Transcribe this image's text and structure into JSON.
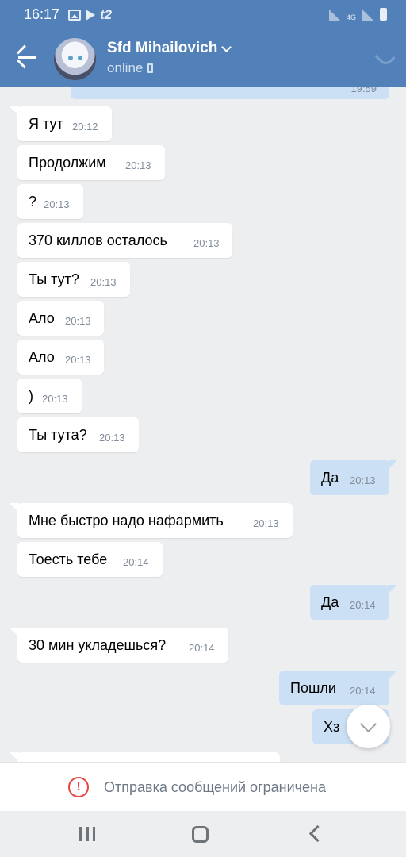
{
  "status_bar": {
    "time": "16:17",
    "carrier": "t2",
    "network": "4G",
    "icons": [
      "image-icon",
      "play-icon",
      "t2-icon",
      "signal-icon",
      "signal-icon",
      "battery-icon"
    ]
  },
  "header": {
    "name": "Sfd Mihailovich",
    "status": "online",
    "icons": [
      "back-arrow-icon",
      "chevron-down-icon",
      "mobile-phone-icon",
      "phone-call-icon"
    ]
  },
  "messages": [
    {
      "dir": "out",
      "text": "",
      "time": "19:59"
    },
    {
      "dir": "in",
      "text": "Я тут",
      "time": "20:12"
    },
    {
      "dir": "in",
      "text": "Продолжим",
      "time": "20:13"
    },
    {
      "dir": "in",
      "text": "?",
      "time": "20:13"
    },
    {
      "dir": "in",
      "text": "370 киллов осталось",
      "time": "20:13"
    },
    {
      "dir": "in",
      "text": "Ты тут?",
      "time": "20:13"
    },
    {
      "dir": "in",
      "text": "Ало",
      "time": "20:13"
    },
    {
      "dir": "in",
      "text": "Ало",
      "time": "20:13"
    },
    {
      "dir": "in",
      "text": ")",
      "time": "20:13"
    },
    {
      "dir": "in",
      "text": "Ты тута?",
      "time": "20:13"
    },
    {
      "dir": "out",
      "text": "Да",
      "time": "20:13"
    },
    {
      "dir": "in",
      "text": "Мне быстро надо нафармить",
      "time": "20:13"
    },
    {
      "dir": "in",
      "text": "Тоесть тебе",
      "time": "20:14"
    },
    {
      "dir": "out",
      "text": "Да",
      "time": "20:14"
    },
    {
      "dir": "in",
      "text": "30 мин укладешься?",
      "time": "20:14"
    },
    {
      "dir": "out",
      "text": "Пошли",
      "time": "20:14"
    },
    {
      "dir": "out",
      "text": "Хз",
      "time": ""
    }
  ],
  "restriction": {
    "text": "Отправка сообщений ограничена",
    "icon": "warning-icon",
    "color": "#e64646"
  },
  "colors": {
    "header": "#5181b8",
    "incoming": "#ffffff",
    "outgoing": "#cce0f5",
    "background": "#edeef0"
  }
}
